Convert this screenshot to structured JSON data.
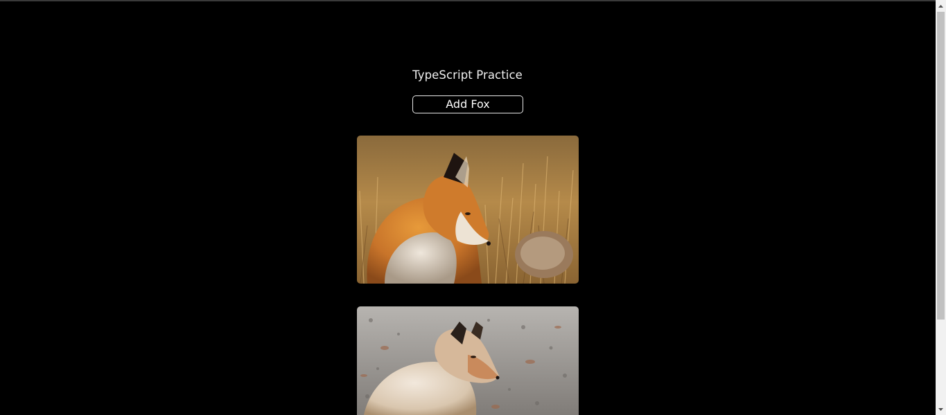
{
  "page": {
    "title": "TypeScript Practice",
    "add_button_label": "Add Fox"
  },
  "foxes": [
    {
      "alt": "Red fox resting in dry golden grass"
    },
    {
      "alt": "Red fox sitting on gravel ground"
    }
  ],
  "colors": {
    "background": "#000000",
    "text": "#ffffff",
    "button_border": "#e8e8e8",
    "scrollbar_track": "#f1f1f1",
    "scrollbar_thumb": "#c1c1c1"
  },
  "scrollbar": {
    "up_icon": "triangle-up-icon",
    "down_icon": "triangle-down-icon"
  }
}
